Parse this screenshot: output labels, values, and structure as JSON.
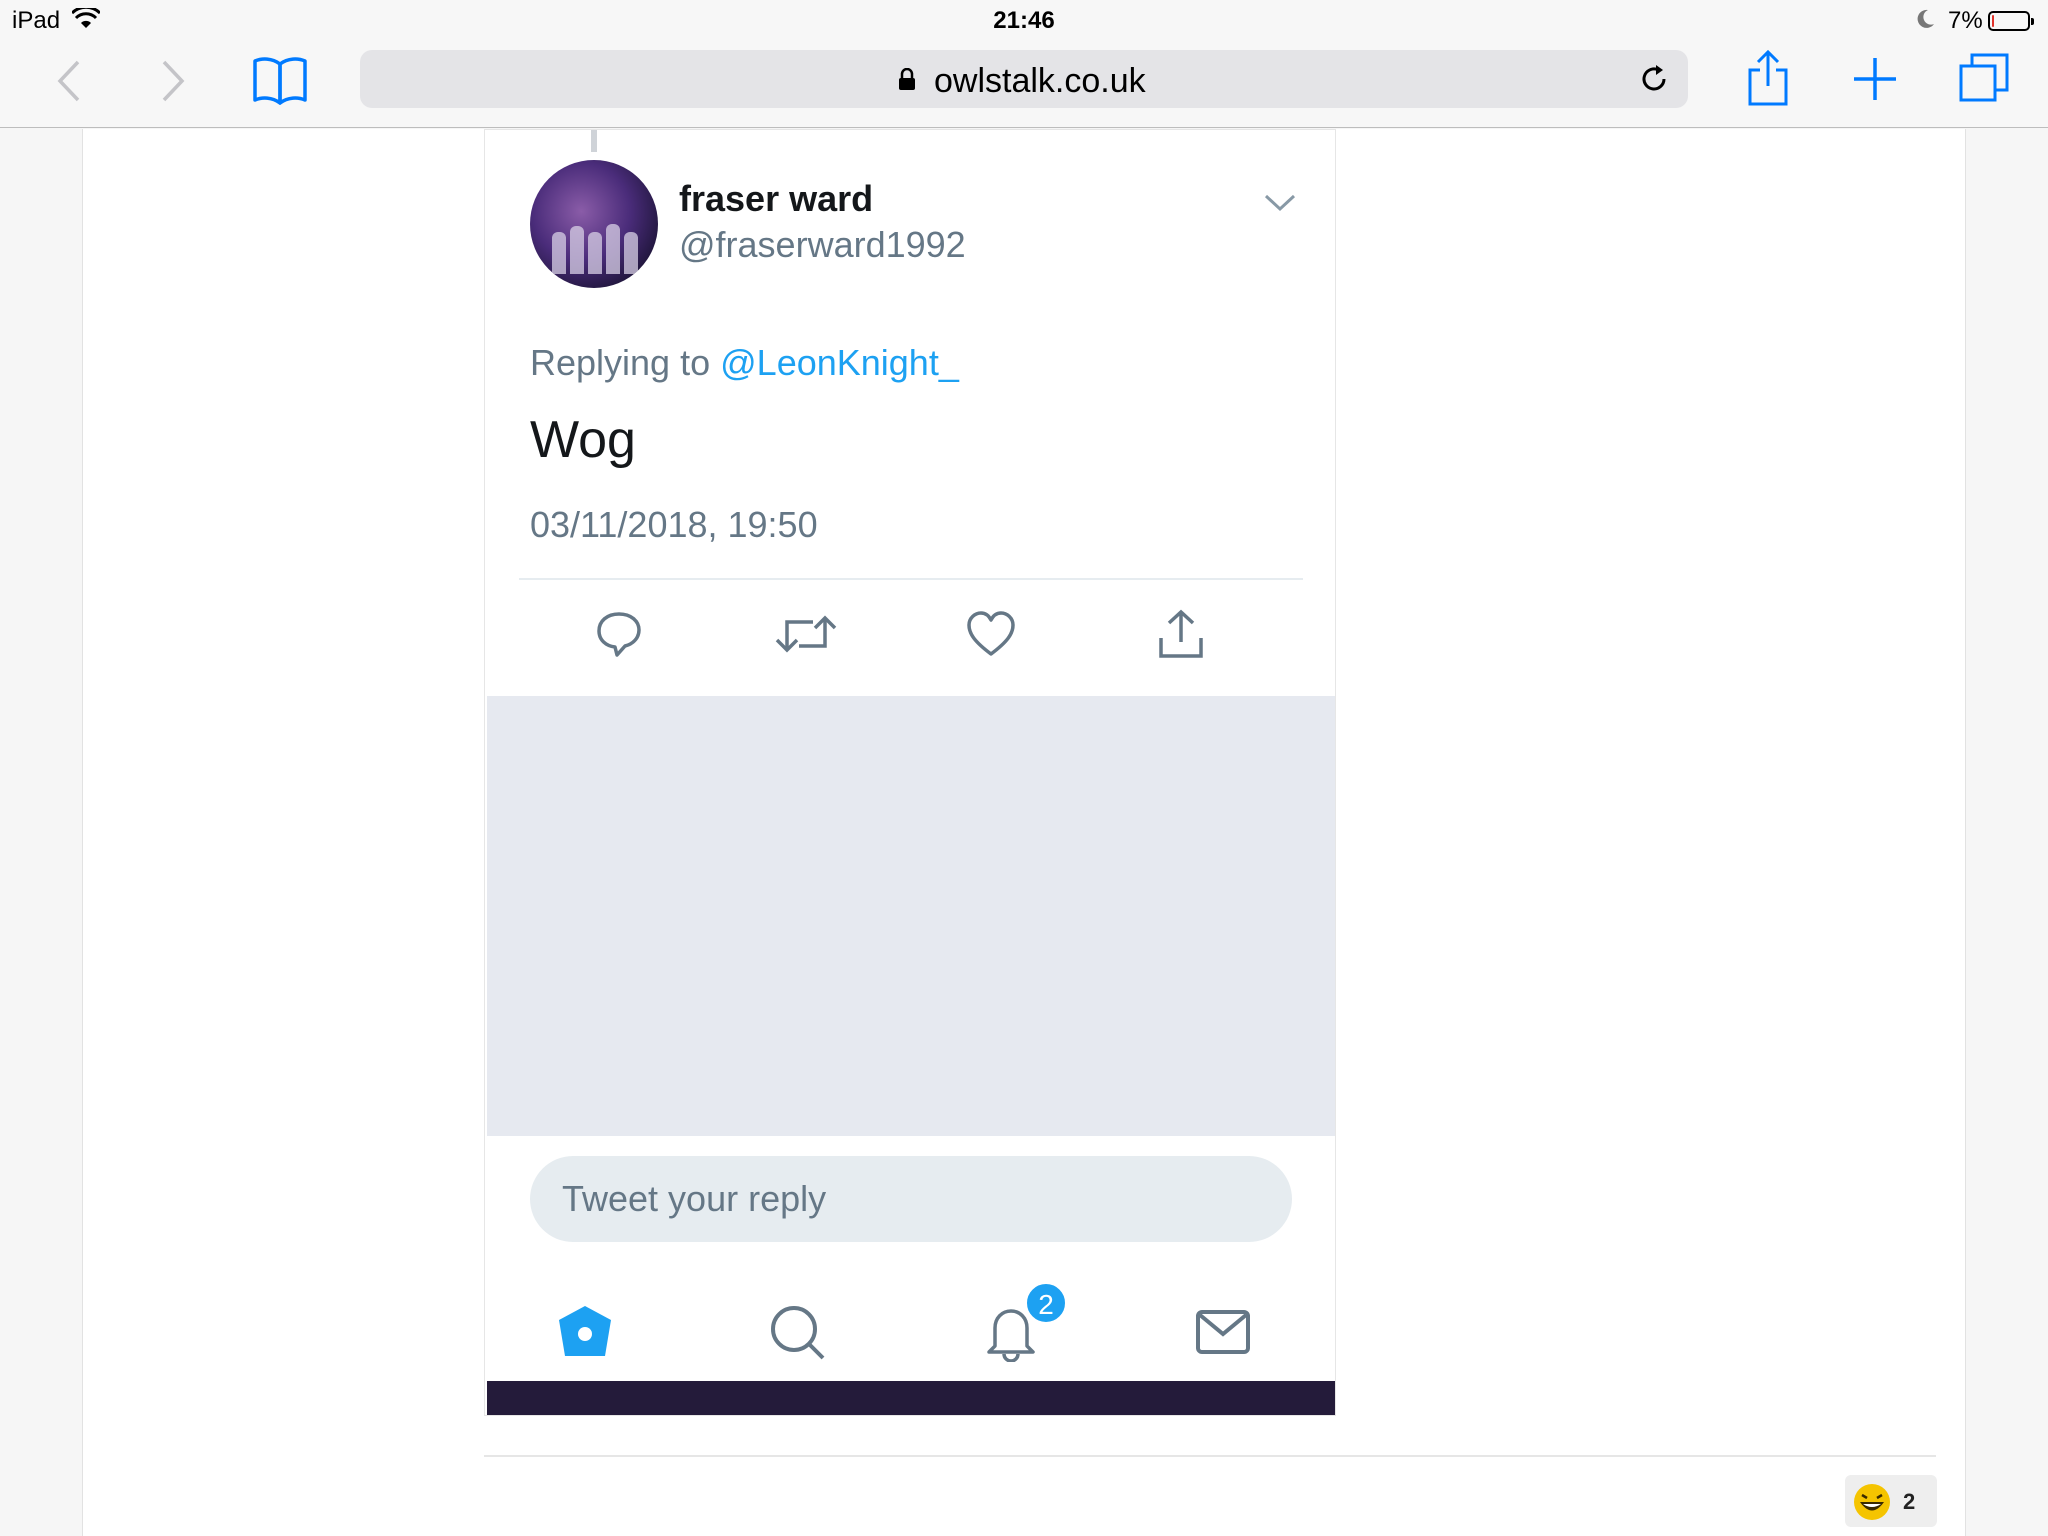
{
  "status_bar": {
    "device": "iPad",
    "time": "21:46",
    "battery_percent_label": "7%",
    "battery_level": 0.07
  },
  "browser": {
    "url": "owlstalk.co.uk",
    "icons": {
      "back": "chevron-left-icon",
      "forward": "chevron-right-icon",
      "bookmarks": "book-icon",
      "reload": "reload-icon",
      "share": "share-icon",
      "new_tab": "plus-icon",
      "tabs": "tabs-icon"
    },
    "accent_color": "#007aff"
  },
  "tweet": {
    "name": "fraser ward",
    "handle": "@fraserward1992",
    "replying_prefix": "Replying to",
    "replying_mention": "@LeonKnight_",
    "text": "Wog",
    "timestamp": "03/11/2018, 19:50",
    "reply_placeholder": "Tweet your reply",
    "notification_count": "2",
    "link_color": "#1da1f2"
  },
  "post": {
    "reaction_emoji": "grinning-face-icon",
    "reaction_count": "2"
  }
}
